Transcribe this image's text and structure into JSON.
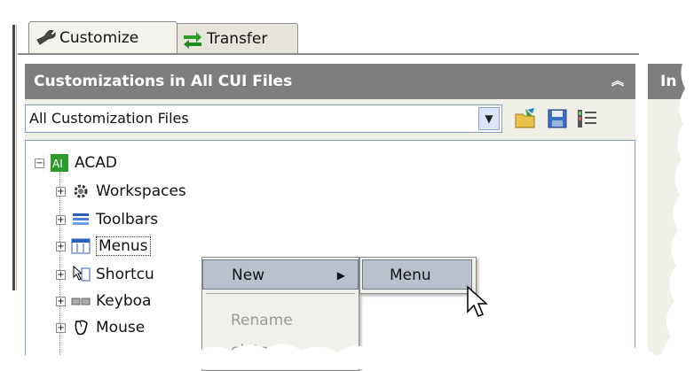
{
  "tabs": [
    {
      "label": "Customize",
      "icon": "wrench-icon"
    },
    {
      "label": "Transfer",
      "icon": "transfer-arrows-icon"
    }
  ],
  "panel": {
    "title": "Customizations in All CUI Files",
    "right_title": "In"
  },
  "filter": {
    "selected": "All Customization Files"
  },
  "tree": {
    "root": "ACAD",
    "items": [
      {
        "label": "Workspaces",
        "icon": "gear-icon"
      },
      {
        "label": "Toolbars",
        "icon": "toolbar-icon"
      },
      {
        "label": "Menus",
        "icon": "menu-icon"
      },
      {
        "label": "Shortcu",
        "icon": "shortcut-menu-icon"
      },
      {
        "label": "Keyboa",
        "icon": "keyboard-icon"
      },
      {
        "label": "Mouse",
        "icon": "mouse-icon"
      }
    ]
  },
  "context_menu": {
    "items": [
      {
        "label": "New",
        "state": "highlighted"
      },
      {
        "label": "Rename",
        "state": "disabled"
      },
      {
        "label": "elete",
        "state": "disabled"
      }
    ],
    "submenu": {
      "label": "Menu"
    }
  },
  "colors": {
    "header": "#7e7e7e",
    "panel_bg": "#f0efe8",
    "highlight": "#b9c2cc"
  }
}
